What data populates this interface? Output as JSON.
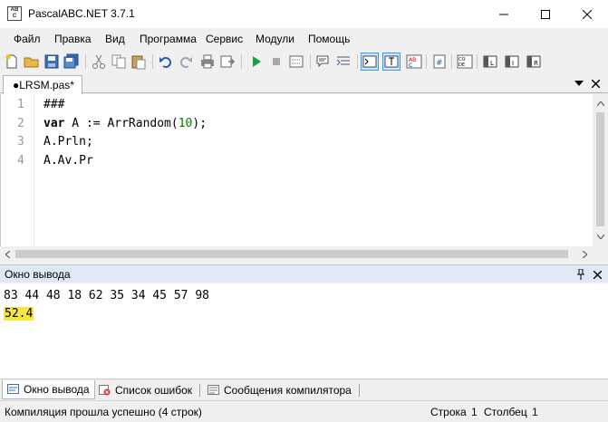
{
  "window": {
    "title": "PascalABC.NET 3.7.1",
    "app_icon_text": "AB C"
  },
  "menu": {
    "items": [
      "Файл",
      "Правка",
      "Вид",
      "Программа",
      "Сервис",
      "Модули",
      "Помощь"
    ]
  },
  "toolbar": {
    "buttons": [
      "new-file-icon",
      "open-folder-icon",
      "save-icon",
      "save-all-icon",
      "cut-icon",
      "copy-icon",
      "paste-icon",
      "undo-icon",
      "redo-icon",
      "print-icon",
      "print-preview-icon",
      "run-icon",
      "stop-icon",
      "debug-step-icon",
      "comment-icon",
      "format-icon",
      "console-icon",
      "text-icon",
      "abc-icon",
      "hash-icon",
      "code-icon",
      "split-left-icon",
      "split-mid-icon",
      "split-right-icon"
    ],
    "pressed": [
      "console-icon",
      "text-icon"
    ]
  },
  "editor_tab": {
    "label": "●LRSM.pas*"
  },
  "editor": {
    "line_numbers": [
      "1",
      "2",
      "3",
      "4"
    ],
    "lines": [
      {
        "parts": [
          {
            "t": "###",
            "c": "plain"
          }
        ]
      },
      {
        "parts": [
          {
            "t": "var",
            "c": "kw"
          },
          {
            "t": " A := ArrRandom(",
            "c": "plain"
          },
          {
            "t": "10",
            "c": "num"
          },
          {
            "t": ");",
            "c": "plain"
          }
        ]
      },
      {
        "parts": [
          {
            "t": "A.Prln;",
            "c": "plain"
          }
        ]
      },
      {
        "parts": [
          {
            "t": "A.Av.Pr",
            "c": "plain"
          }
        ]
      }
    ]
  },
  "output_panel": {
    "title": "Окно вывода",
    "lines": [
      "83 44 48 18 62 35 34 45 57 98",
      "52.4"
    ],
    "highlighted_line": "52.4"
  },
  "bottom_tabs": {
    "items": [
      {
        "label": "Окно вывода",
        "active": true
      },
      {
        "label": "Список ошибок",
        "active": false
      },
      {
        "label": "Сообщения компилятора",
        "active": false
      }
    ]
  },
  "status": {
    "message": "Компиляция прошла успешно (4 строк)",
    "row_label": "Строка",
    "row_value": "1",
    "col_label": "Столбец",
    "col_value": "1"
  },
  "colors": {
    "accent": "#3399ff",
    "output_highlight": "#f5e642",
    "panel_header": "#dfe9f5",
    "number_literal": "#008000"
  }
}
